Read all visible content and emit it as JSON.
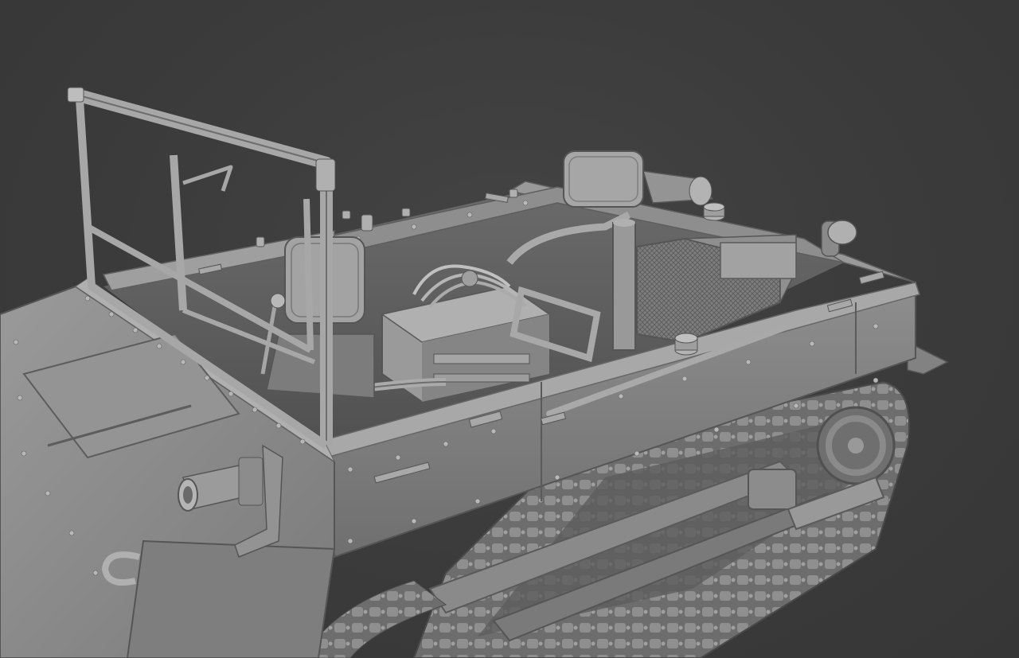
{
  "scene": {
    "subject": "carrier-vehicle-3d-model",
    "background_color": "#3b3b3b",
    "model_color": "#8c8c8c"
  }
}
